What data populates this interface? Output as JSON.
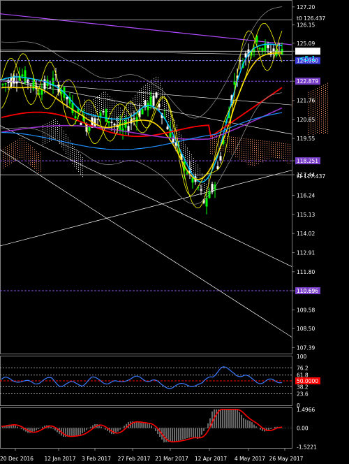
{
  "chart_data": [
    {
      "type": "candlestick",
      "panel": "price",
      "instrument_text": {
        "ratio_label": "<5:1",
        "t0_label": "t0 126.437",
        "t1_label": "t1 117.437"
      },
      "y_ticks": [
        "127.20",
        "126.15",
        "125.09",
        "124.622",
        "124.080",
        "122.879",
        "121.76",
        "120.65",
        "119.55",
        "118.251",
        "117.44",
        "116.24",
        "115.13",
        "114.02",
        "112.91",
        "111.80",
        "110.696",
        "110.69",
        "109.58",
        "108.50",
        "107.39"
      ],
      "highlight_levels": {
        "current_price": 124.622,
        "level_blue_box": 124.08,
        "level_purple_1": 122.879,
        "level_purple_2": 118.251,
        "level_purple_3": 110.696
      },
      "colors": {
        "bull_candle": "#00ff00",
        "bear_candle": "#ffffff",
        "ma_fast": "#00bfff",
        "ma_slow": "#ff0000",
        "ma_yellow": "#ffd700",
        "envelope": "#ffff00",
        "ichimoku_long": "#ffffff",
        "ichimoku_short": "#ff7f50",
        "purple_line": "#9932cc"
      },
      "ylim": [
        107.0,
        127.6
      ]
    },
    {
      "type": "line",
      "panel": "rsi",
      "y_ticks": [
        "100",
        "76.2",
        "61.8",
        "50.0000",
        "38.2",
        "23.6",
        "0"
      ],
      "current_value_label": "50.0000",
      "ylim": [
        0,
        100
      ]
    },
    {
      "type": "histogram",
      "panel": "macd",
      "y_ticks": [
        "1.4966",
        "0.00",
        "-1.5221"
      ],
      "ylim": [
        -1.6,
        1.6
      ]
    }
  ],
  "x_ticks": [
    "20 Dec 2016",
    "12 Jan 2017",
    "3 Feb 2017",
    "27 Feb 2017",
    "21 Mar 2017",
    "12 Apr 2017",
    "4 May 2017",
    "26 May 2017"
  ]
}
